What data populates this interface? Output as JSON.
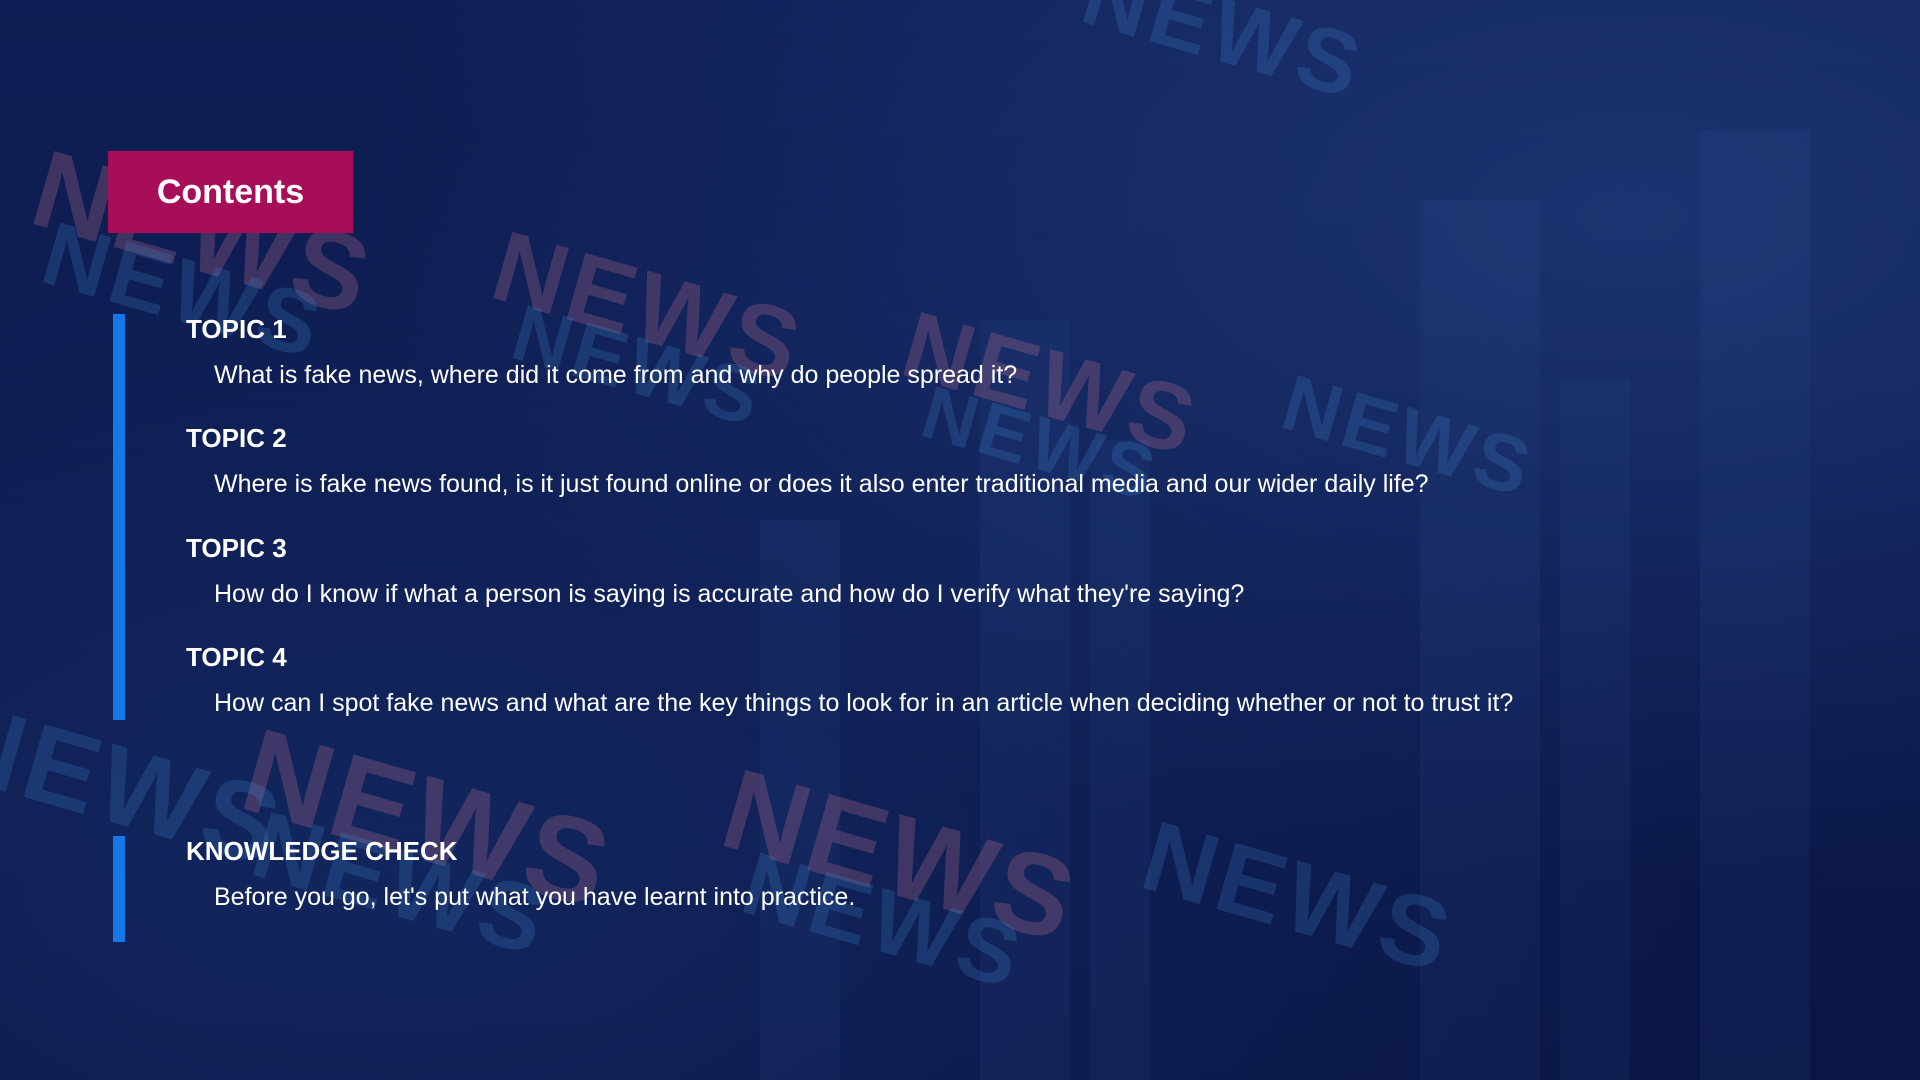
{
  "slide": {
    "heading": "Contents",
    "topics": [
      {
        "title": "TOPIC 1",
        "description": "What is fake news, where did it come from and why do people spread it?"
      },
      {
        "title": "TOPIC 2",
        "description": "Where is fake news found, is it just found online or does it also enter traditional media and our wider daily life?"
      },
      {
        "title": "TOPIC 3",
        "description": "How do I know if what a person is saying is accurate and how do I verify what they're saying?"
      },
      {
        "title": "TOPIC 4",
        "description": "How can I spot fake news and what are the key things to look for in an article when deciding whether or not to trust it?"
      }
    ],
    "knowledge_check": {
      "title": "KNOWLEDGE CHECK",
      "description": "Before you go, let's put what you have learnt into practice."
    }
  },
  "background": {
    "watermark_text": "NEWS"
  },
  "colors": {
    "background": "#0d1a4e",
    "badge": "#a80d58",
    "accent_bar": "#1677e8",
    "text": "#ffffff"
  }
}
